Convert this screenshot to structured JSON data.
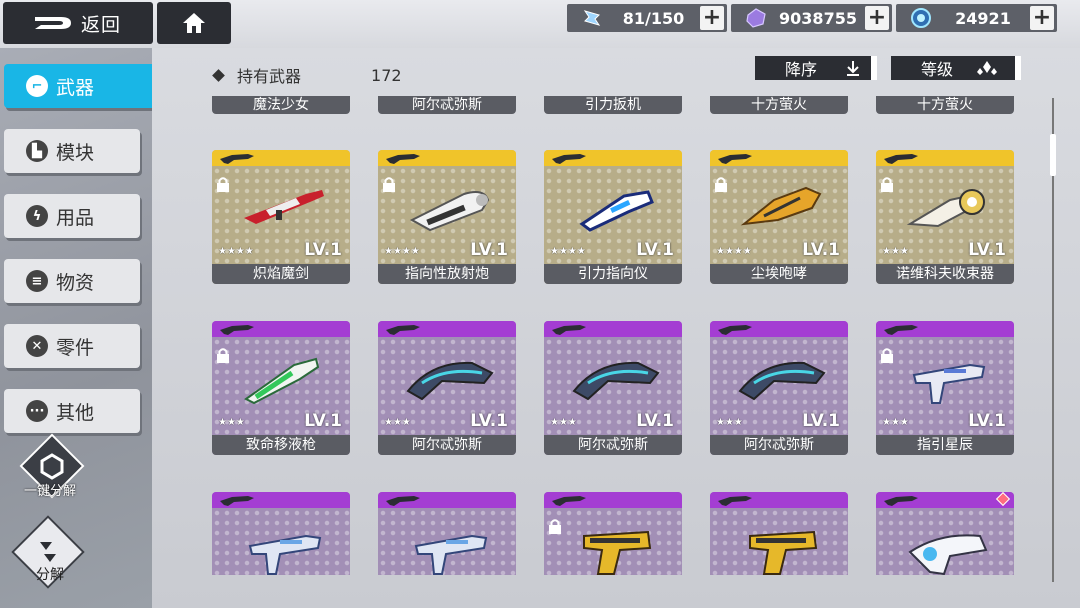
{
  "topbar": {
    "back_label": "返回",
    "resources": [
      {
        "icon": "stamina-icon",
        "value": "81/150"
      },
      {
        "icon": "crystal-icon",
        "value": "9038755"
      },
      {
        "icon": "energy-orb-icon",
        "value": "24921"
      }
    ],
    "plus": "+"
  },
  "sidebar": {
    "items": [
      {
        "label": "武器",
        "icon": "gun-icon",
        "glyph": "⌐",
        "active": true
      },
      {
        "label": "模块",
        "icon": "module-icon",
        "glyph": "▙"
      },
      {
        "label": "用品",
        "icon": "lightning-icon",
        "glyph": "ϟ"
      },
      {
        "label": "物资",
        "icon": "supply-icon",
        "glyph": "≡"
      },
      {
        "label": "零件",
        "icon": "parts-icon",
        "glyph": "✕"
      },
      {
        "label": "其他",
        "icon": "more-icon",
        "glyph": "···"
      }
    ],
    "quick_dismantle_label": "一键分解",
    "dismantle_label": "分解"
  },
  "header": {
    "owned_label": "持有武器",
    "owned_count": "172",
    "sort_order_label": "降序",
    "sort_key_label": "等级"
  },
  "partial_row": [
    "魔法少女",
    "阿尔忒弥斯",
    "引力扳机",
    "十方萤火",
    "十方萤火"
  ],
  "cards": [
    {
      "name": "炽焰魔剑",
      "lv": "LV.1",
      "stars": "★★★★",
      "rarity": "gold",
      "locked": true,
      "weapon": "rifle"
    },
    {
      "name": "指向性放射炮",
      "lv": "LV.1",
      "stars": "★★★★",
      "rarity": "gold",
      "locked": true,
      "weapon": "cannon"
    },
    {
      "name": "引力指向仪",
      "lv": "LV.1",
      "stars": "★★★★",
      "rarity": "gold",
      "locked": false,
      "weapon": "gravity"
    },
    {
      "name": "尘埃咆哮",
      "lv": "LV.1",
      "stars": "★★★★",
      "rarity": "gold",
      "locked": true,
      "weapon": "golden"
    },
    {
      "name": "诺维科夫收束器",
      "lv": "LV.1",
      "stars": "★★★",
      "rarity": "gold",
      "locked": true,
      "weapon": "collector"
    },
    {
      "name": "致命移液枪",
      "lv": "LV.1",
      "stars": "★★★",
      "rarity": "purple",
      "locked": true,
      "weapon": "pipette"
    },
    {
      "name": "阿尔忒弥斯",
      "lv": "LV.1",
      "stars": "★★★",
      "rarity": "purple",
      "locked": false,
      "weapon": "artemis"
    },
    {
      "name": "阿尔忒弥斯",
      "lv": "LV.1",
      "stars": "★★★",
      "rarity": "purple",
      "locked": false,
      "weapon": "artemis"
    },
    {
      "name": "阿尔忒弥斯",
      "lv": "LV.1",
      "stars": "★★★",
      "rarity": "purple",
      "locked": false,
      "weapon": "artemis"
    },
    {
      "name": "指引星辰",
      "lv": "LV.1",
      "stars": "★★★",
      "rarity": "purple",
      "locked": true,
      "weapon": "smg"
    },
    {
      "name": "",
      "lv": "",
      "stars": "",
      "rarity": "purple",
      "locked": false,
      "weapon": "smg2"
    },
    {
      "name": "",
      "lv": "",
      "stars": "",
      "rarity": "purple",
      "locked": false,
      "weapon": "smg2"
    },
    {
      "name": "",
      "lv": "",
      "stars": "",
      "rarity": "purple",
      "locked": true,
      "weapon": "pistol"
    },
    {
      "name": "",
      "lv": "",
      "stars": "",
      "rarity": "purple",
      "locked": false,
      "weapon": "pistol"
    },
    {
      "name": "",
      "lv": "",
      "stars": "",
      "rarity": "purple",
      "locked": false,
      "weapon": "blaster",
      "gem": true
    }
  ],
  "colors": {
    "accent": "#19b6e6",
    "gold_rarity": "#f0c42a",
    "purple_rarity": "#a43dd3",
    "dark_button": "#2b2d33"
  }
}
